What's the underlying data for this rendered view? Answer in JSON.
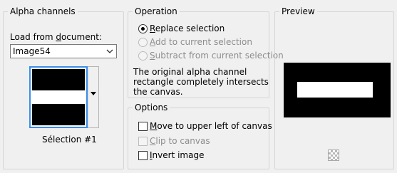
{
  "alpha_channels": {
    "title": "Alpha channels",
    "load_from_label": "Load from ",
    "load_from_label_accel": "d",
    "load_from_label_rest": "ocument:",
    "document_value": "Image54",
    "selection_name": "Sélection #1"
  },
  "operation": {
    "title": "Operation",
    "options": [
      {
        "accel": "R",
        "rest": "eplace selection",
        "selected": true,
        "enabled": true
      },
      {
        "accel": "A",
        "rest": "dd to current selection",
        "selected": false,
        "enabled": false
      },
      {
        "accel": "S",
        "rest": "ubtract from current selection",
        "selected": false,
        "enabled": false
      }
    ],
    "description": "The original alpha channel rectangle completely intersects the canvas."
  },
  "options": {
    "title": "Options",
    "move_to_upper_left": {
      "accel": "M",
      "rest": "ove to upper left of canvas",
      "checked": false,
      "enabled": true
    },
    "clip_to_canvas": {
      "accel": "C",
      "rest": "lip to canvas",
      "checked": false,
      "enabled": false
    },
    "invert_image": {
      "accel": "I",
      "rest": "nvert image",
      "checked": false,
      "enabled": true
    }
  },
  "preview": {
    "title": "Preview",
    "toggle_icon": "checkerboard-icon"
  },
  "colors": {
    "thumb_selection_border": "#3c8ee8",
    "mask_black": "#000000",
    "mask_white": "#ffffff"
  }
}
